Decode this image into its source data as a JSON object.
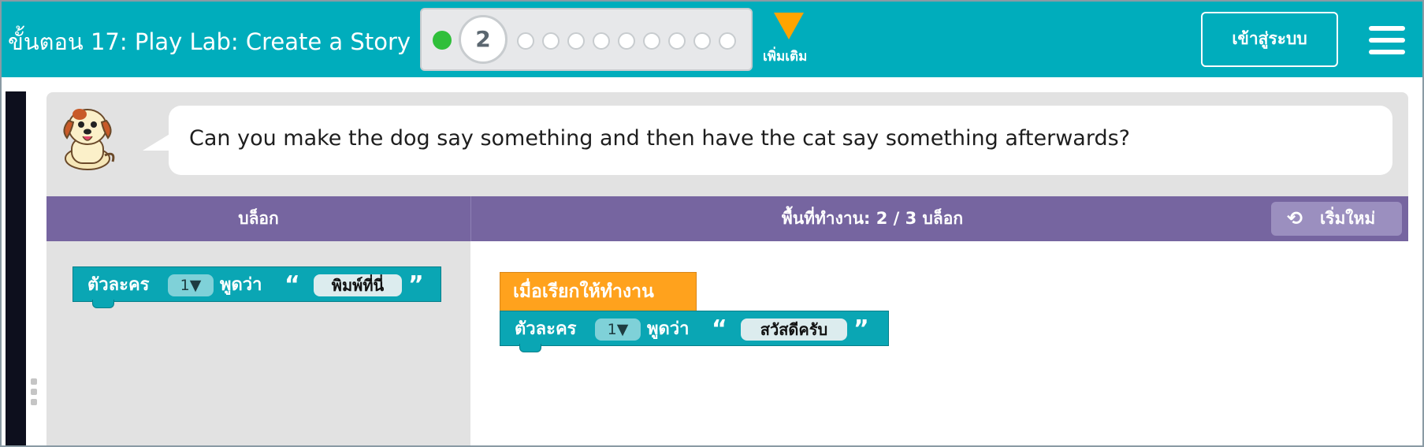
{
  "header": {
    "stage_title": "ขั้นตอน 17: Play Lab: Create a Story",
    "progress": {
      "current_level": "2",
      "remaining_dots": 9
    },
    "more_label": "เพิ่มเติม",
    "signin_label": "เข้าสู่ระบบ",
    "menu_icon": "hamburger-menu-icon"
  },
  "instructions": {
    "avatar_icon": "dog-character-icon",
    "text": "Can you make the dog say something and then have the cat say something afterwards?"
  },
  "toolbar": {
    "toolbox_title": "บล็อก",
    "workspace_title": "พื้นที่ทำงาน: 2 / 3 บล็อก",
    "reset_label": "เริ่มใหม่",
    "reset_icon": "undo-icon"
  },
  "toolbox_block": {
    "label_actor": "ตัวละคร",
    "actor_value": "1▼",
    "label_say": "พูดว่า",
    "open_quote": "“",
    "text_value": "พิมพ์ที่นี่",
    "close_quote": "”"
  },
  "workspace_blocks": {
    "when_run_label": "เมื่อเรียกให้ทำงาน",
    "say_block": {
      "label_actor": "ตัวละคร",
      "actor_value": "1▼",
      "label_say": "พูดว่า",
      "open_quote": "“",
      "text_value": "สวัสดีครับ",
      "close_quote": "”"
    }
  },
  "colors": {
    "header": "#00adbc",
    "block_teal": "#0aa6b4",
    "block_orange": "#ffa21d",
    "bar_purple": "#7665a0",
    "progress_done": "#2fbf3a",
    "more_arrow": "#ffa400"
  }
}
